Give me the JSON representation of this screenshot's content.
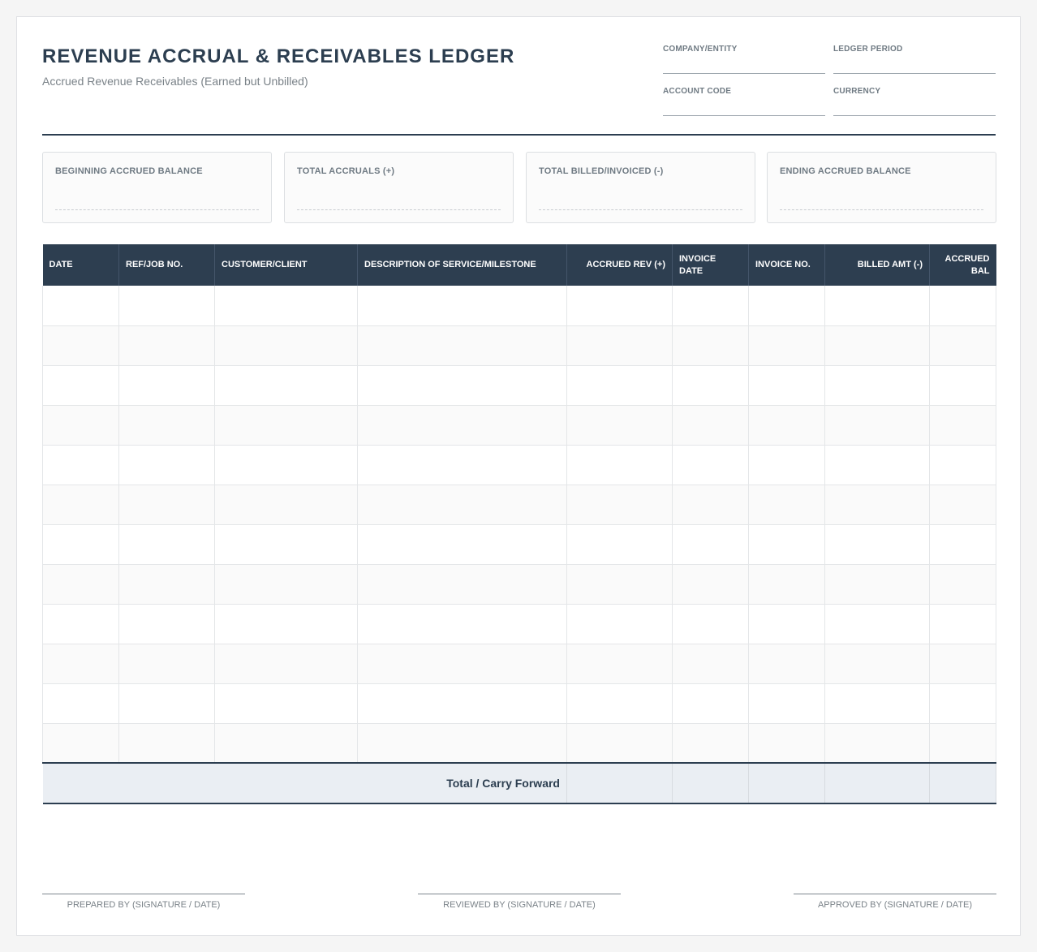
{
  "header": {
    "title": "REVENUE ACCRUAL & RECEIVABLES LEDGER",
    "subtitle": "Accrued Revenue Receivables (Earned but Unbilled)"
  },
  "meta_fields": {
    "company": "COMPANY/ENTITY",
    "period": "LEDGER PERIOD",
    "account_code": "ACCOUNT CODE",
    "currency": "CURRENCY"
  },
  "summary_cards": {
    "beginning": "BEGINNING ACCRUED BALANCE",
    "accruals": "TOTAL ACCRUALS (+)",
    "billed": "TOTAL BILLED/INVOICED (-)",
    "ending": "ENDING ACCRUED BALANCE"
  },
  "table": {
    "columns": [
      "DATE",
      "REF/JOB NO.",
      "CUSTOMER/CLIENT",
      "DESCRIPTION OF SERVICE/MILESTONE",
      "ACCRUED REV (+)",
      "INVOICE DATE",
      "INVOICE NO.",
      "BILLED AMT (-)",
      "ACCRUED BAL"
    ],
    "total_label": "Total / Carry Forward"
  },
  "signatures": {
    "prepared": "PREPARED BY (SIGNATURE / DATE)",
    "reviewed": "REVIEWED BY (SIGNATURE / DATE)",
    "approved": "APPROVED BY (SIGNATURE / DATE)"
  }
}
